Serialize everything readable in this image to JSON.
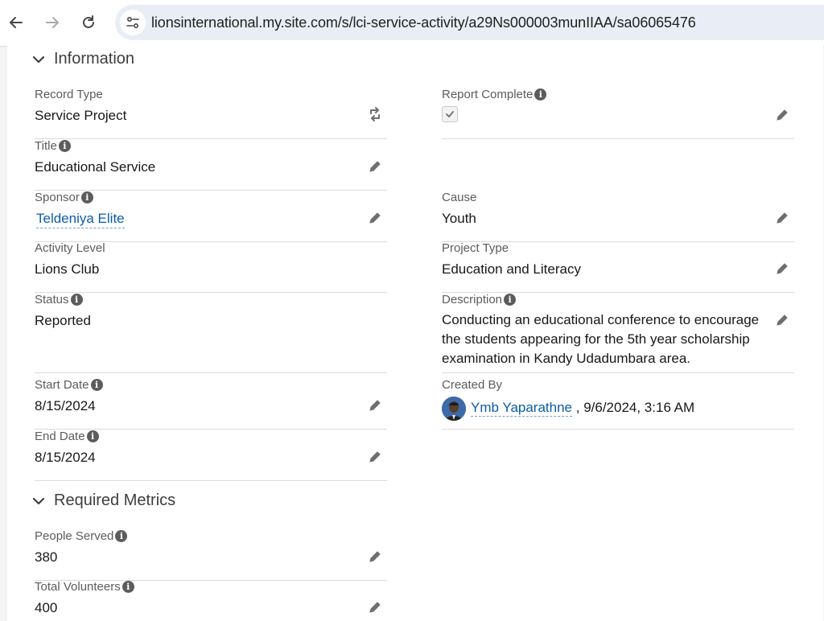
{
  "browser": {
    "url": "lionsinternational.my.site.com/s/lci-service-activity/a29Ns000003munIIAA/sa06065476"
  },
  "sections": {
    "information": "Information",
    "required_metrics": "Required Metrics"
  },
  "fields": {
    "record_type": {
      "label": "Record Type",
      "value": "Service Project"
    },
    "report_complete": {
      "label": "Report Complete",
      "checked": true
    },
    "title": {
      "label": "Title",
      "value": "Educational Service"
    },
    "sponsor": {
      "label": "Sponsor",
      "value": "Teldeniya Elite"
    },
    "cause": {
      "label": "Cause",
      "value": "Youth"
    },
    "activity_level": {
      "label": "Activity Level",
      "value": "Lions Club"
    },
    "project_type": {
      "label": "Project Type",
      "value": "Education and Literacy"
    },
    "status": {
      "label": "Status",
      "value": "Reported"
    },
    "description": {
      "label": "Description",
      "value": "Conducting an educational conference to encourage the students appearing for the 5th year scholarship examination in Kandy Udadumbara area."
    },
    "start_date": {
      "label": "Start Date",
      "value": "8/15/2024"
    },
    "created_by": {
      "label": "Created By",
      "user": "Ymb Yaparathne",
      "separator": " , ",
      "timestamp": "9/6/2024, 3:16 AM"
    },
    "end_date": {
      "label": "End Date",
      "value": "8/15/2024"
    },
    "people_served": {
      "label": "People Served",
      "value": "380"
    },
    "total_volunteers": {
      "label": "Total Volunteers",
      "value": "400"
    }
  },
  "colors": {
    "link": "#0b5cab",
    "border": "#dddbda",
    "label": "#5c5c5c",
    "icon": "#706e6b"
  }
}
